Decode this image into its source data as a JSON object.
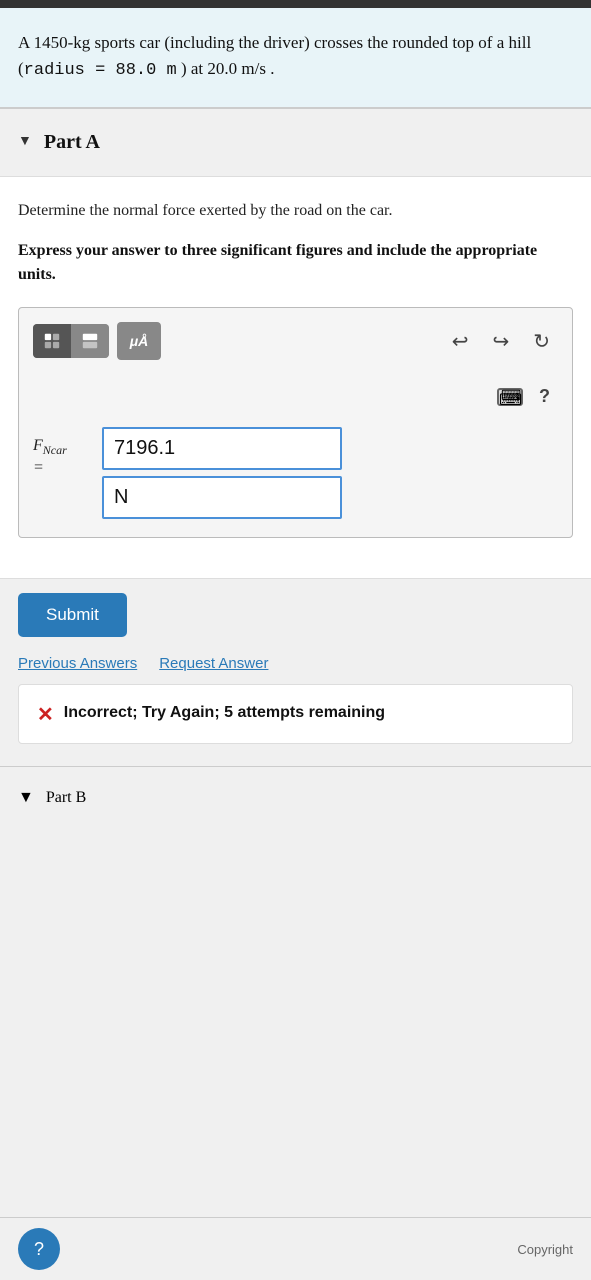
{
  "topBar": {},
  "problemStatement": {
    "text": "A 1450-kg sports car (including the driver) crosses the rounded top of a hill (radius = 88.0 m ) at 20.0 m/s .",
    "massValue": "1450",
    "massUnit": "kg",
    "radiusLabel": "radius",
    "radiusValue": "88.0",
    "radiusUnit": "m",
    "speedValue": "20.0",
    "speedUnit": "m/s"
  },
  "partA": {
    "label": "Part A",
    "description": "Determine the normal force exerted by the road on the car.",
    "instruction": "Express your answer to three significant figures and include the appropriate units.",
    "answerLabel": "F",
    "answerSubscript": "Ncar",
    "answerEquals": "=",
    "valueInput": "7196.1",
    "unitInput": "N",
    "submitLabel": "Submit",
    "previousAnswersLabel": "Previous Answers",
    "requestAnswerLabel": "Request Answer",
    "feedback": {
      "iconSymbol": "✕",
      "text": "Incorrect; Try Again; 5 attempts remaining"
    }
  },
  "partB": {
    "label": "Part B"
  },
  "toolbar": {
    "undoLabel": "↩",
    "redoLabel": "↪",
    "resetLabel": "↻",
    "helpLabel": "?",
    "symbolLabel": "μÅ"
  },
  "bottomBar": {
    "copyrightLabel": "Copyright"
  }
}
